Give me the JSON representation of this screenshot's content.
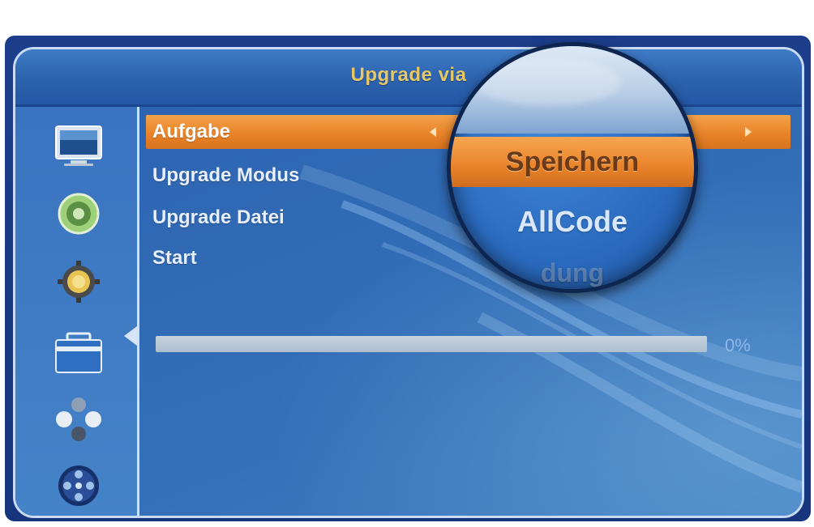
{
  "window": {
    "title_prefix": "Upgrade via"
  },
  "sidebar": {
    "items": [
      {
        "icon": "tv-icon"
      },
      {
        "icon": "speaker-icon"
      },
      {
        "icon": "settings-gear-icon"
      },
      {
        "icon": "toolbox-icon",
        "active": true
      },
      {
        "icon": "network-icon"
      },
      {
        "icon": "film-reel-icon"
      }
    ]
  },
  "menu": {
    "items": [
      {
        "label": "Aufgabe",
        "selected": true
      },
      {
        "label": "Upgrade Modus"
      },
      {
        "label": "Upgrade Datei"
      },
      {
        "label": "Start"
      }
    ]
  },
  "progress": {
    "value_percent": 0,
    "label": "0%"
  },
  "magnifier": {
    "selected_value": "Speichern",
    "option_2": "AllCode",
    "option_3": "dung"
  },
  "colors": {
    "highlight": "#e9842a",
    "title_text": "#e7c766",
    "panel_blue": "#2e67b4"
  }
}
